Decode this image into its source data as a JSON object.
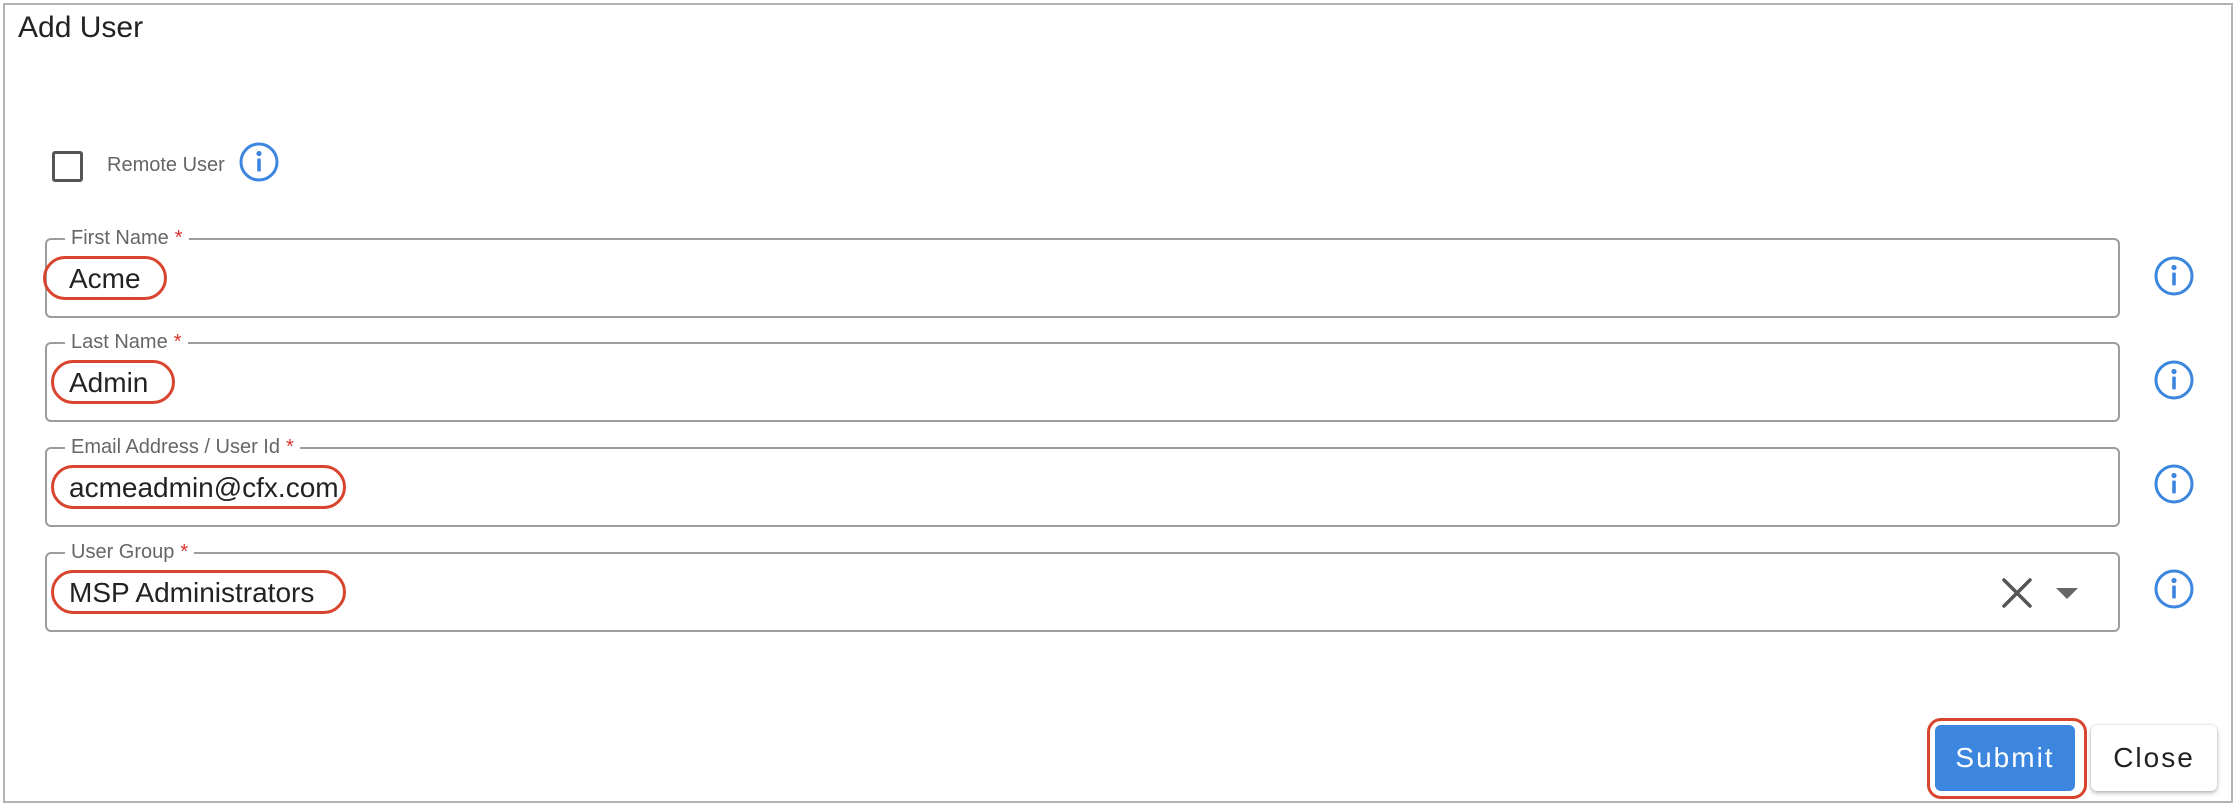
{
  "dialog": {
    "title": "Add User"
  },
  "remote_user": {
    "label": "Remote User",
    "checked": false
  },
  "fields": {
    "first_name": {
      "label": "First Name",
      "required_mark": "*",
      "value": "Acme"
    },
    "last_name": {
      "label": "Last Name",
      "required_mark": "*",
      "value": "Admin"
    },
    "email": {
      "label": "Email Address / User Id",
      "required_mark": "*",
      "value": "acmeadmin@cfx.com"
    },
    "user_group": {
      "label": "User Group",
      "required_mark": "*",
      "value": "MSP Administrators"
    }
  },
  "buttons": {
    "submit_label": "Submit",
    "close_label": "Close"
  },
  "icons": {
    "info": "info-circle-icon",
    "clear": "close-icon",
    "dropdown": "caret-down-icon",
    "checkbox": "checkbox-unchecked"
  },
  "colors": {
    "accent": "#3d86e0",
    "required": "#d9332b",
    "annotation": "#d9442e",
    "border": "#9c9c9c"
  }
}
